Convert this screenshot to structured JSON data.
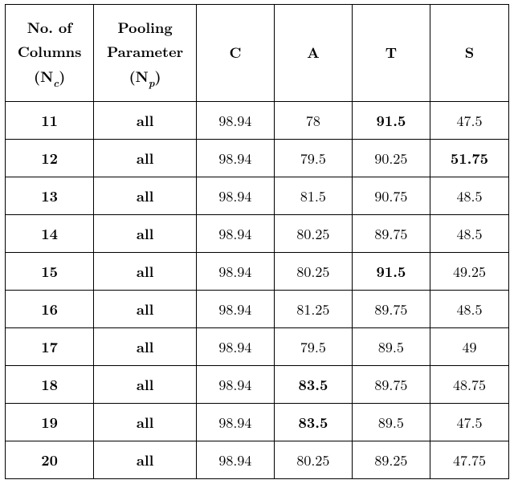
{
  "chart_data": {
    "type": "table",
    "columns": [
      "No. of Columns (N_c)",
      "Pooling Parameter (N_p)",
      "C",
      "A",
      "T",
      "S"
    ],
    "rows": [
      [
        11,
        "all",
        98.94,
        78,
        91.5,
        47.5
      ],
      [
        12,
        "all",
        98.94,
        79.5,
        90.25,
        51.75
      ],
      [
        13,
        "all",
        98.94,
        81.5,
        90.75,
        48.5
      ],
      [
        14,
        "all",
        98.94,
        80.25,
        89.75,
        48.5
      ],
      [
        15,
        "all",
        98.94,
        80.25,
        91.5,
        49.25
      ],
      [
        16,
        "all",
        98.94,
        81.25,
        89.75,
        48.5
      ],
      [
        17,
        "all",
        98.94,
        79.5,
        89.5,
        49
      ],
      [
        18,
        "all",
        98.94,
        83.5,
        89.75,
        48.75
      ],
      [
        19,
        "all",
        98.94,
        83.5,
        89.5,
        47.5
      ],
      [
        20,
        "all",
        98.94,
        80.25,
        89.25,
        47.75
      ]
    ],
    "bold_cells": {
      "0": [
        "T"
      ],
      "1": [
        "S"
      ],
      "4": [
        "T"
      ],
      "7": [
        "A"
      ],
      "8": [
        "A"
      ]
    }
  },
  "headers": {
    "nc_line1": "No. of",
    "nc_line2": "Columns",
    "nc_paren_open": "(N",
    "nc_sub": "c",
    "nc_paren_close": ")",
    "np_line1": "Pooling",
    "np_line2": "Parameter",
    "np_paren_open": "(N",
    "np_sub": "p",
    "np_paren_close": ")",
    "c": "C",
    "a": "A",
    "t": "T",
    "s": "S"
  },
  "rows": [
    {
      "nc": "11",
      "np": "all",
      "c": "98.94",
      "a": "78",
      "t": "91.5",
      "s": "47.5"
    },
    {
      "nc": "12",
      "np": "all",
      "c": "98.94",
      "a": "79.5",
      "t": "90.25",
      "s": "51.75"
    },
    {
      "nc": "13",
      "np": "all",
      "c": "98.94",
      "a": "81.5",
      "t": "90.75",
      "s": "48.5"
    },
    {
      "nc": "14",
      "np": "all",
      "c": "98.94",
      "a": "80.25",
      "t": "89.75",
      "s": "48.5"
    },
    {
      "nc": "15",
      "np": "all",
      "c": "98.94",
      "a": "80.25",
      "t": "91.5",
      "s": "49.25"
    },
    {
      "nc": "16",
      "np": "all",
      "c": "98.94",
      "a": "81.25",
      "t": "89.75",
      "s": "48.5"
    },
    {
      "nc": "17",
      "np": "all",
      "c": "98.94",
      "a": "79.5",
      "t": "89.5",
      "s": "49"
    },
    {
      "nc": "18",
      "np": "all",
      "c": "98.94",
      "a": "83.5",
      "t": "89.75",
      "s": "48.75"
    },
    {
      "nc": "19",
      "np": "all",
      "c": "98.94",
      "a": "83.5",
      "t": "89.5",
      "s": "47.5"
    },
    {
      "nc": "20",
      "np": "all",
      "c": "98.94",
      "a": "80.25",
      "t": "89.25",
      "s": "47.75"
    }
  ],
  "bold": [
    {
      "t": true
    },
    {
      "s": true
    },
    {},
    {},
    {
      "t": true
    },
    {},
    {},
    {
      "a": true
    },
    {
      "a": true
    },
    {}
  ]
}
